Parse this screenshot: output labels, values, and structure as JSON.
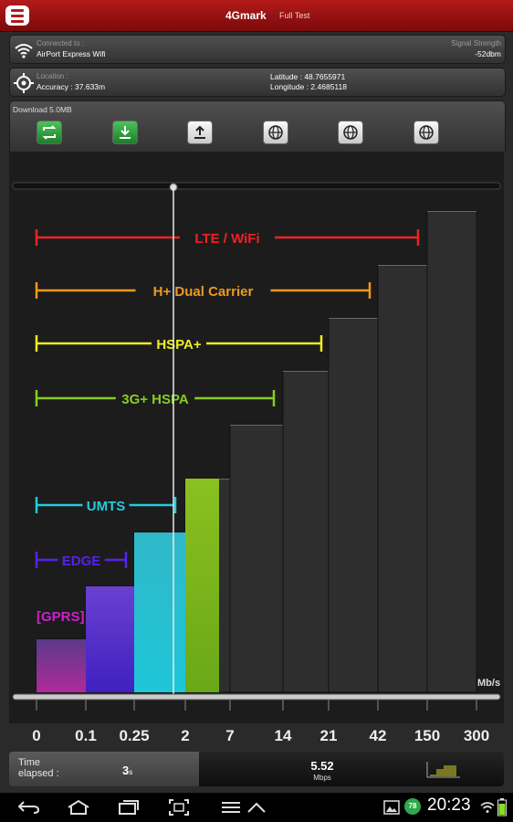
{
  "app": {
    "title": "4Gmark",
    "subtitle": "Full Test"
  },
  "connection": {
    "label": "Connected to :",
    "value": "AirPort Express Wifi",
    "signal_label": "Signal Strength",
    "signal_value": "-52dbm"
  },
  "location": {
    "label": "Location :",
    "accuracy": "Accuracy : 37.633m",
    "latitude": "Latitude : 48.7655971",
    "longitude": "Longitude : 2.4685118"
  },
  "download": {
    "label": "Download  5.0MB"
  },
  "toolbar": {
    "icons": [
      "repeat-icon",
      "download-icon",
      "upload-icon",
      "globe-icon",
      "globe-icon",
      "globe-icon"
    ]
  },
  "chart_data": {
    "type": "bar",
    "title": "",
    "xlabel": "Mb/s",
    "categories": [
      "0",
      "0.1",
      "0.25",
      "2",
      "7",
      "14",
      "21",
      "42",
      "150",
      "300"
    ],
    "gauge_value_mbps": 5.52,
    "technologies": [
      {
        "name": "GPRS",
        "color": "#cc22cc"
      },
      {
        "name": "EDGE",
        "color": "#5522ee"
      },
      {
        "name": "UMTS",
        "color": "#22ccdd"
      },
      {
        "name": "3G+ HSPA",
        "color": "#88cc22"
      },
      {
        "name": "HSPA+",
        "color": "#eeee22"
      },
      {
        "name": "H+ Dual Carrier",
        "color": "#ee9922"
      },
      {
        "name": "LTE / WiFi",
        "color": "#ee2222"
      }
    ]
  },
  "stats": {
    "time_label": "Time\nelapsed :",
    "time_value": "3",
    "time_unit": "s",
    "speed_value": "5.52",
    "speed_unit": "Mbps"
  },
  "status_bar": {
    "clock": "20:23",
    "badge": "78"
  },
  "colors": {
    "accent": "#b41a1a"
  }
}
